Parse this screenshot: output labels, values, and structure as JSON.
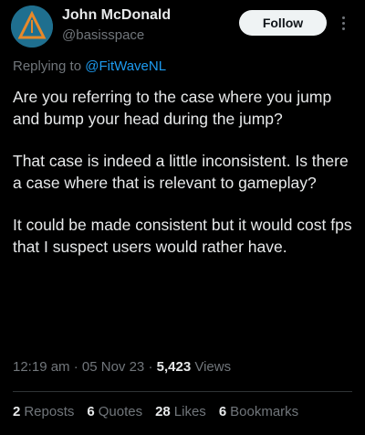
{
  "author": {
    "name": "John McDonald",
    "handle": "@basisspace"
  },
  "follow_label": "Follow",
  "reply": {
    "prefix": "Replying to ",
    "to": "@FitWaveNL"
  },
  "tweet": {
    "paragraphs": [
      "Are you referring to the case where you jump and bump your head during the jump?",
      "That case is indeed a little inconsistent. Is there a case where that is relevant to gameplay?",
      "It could be made consistent but it would cost fps that I suspect users would rather have."
    ]
  },
  "meta": {
    "time": "12:19 am",
    "sep1": " · ",
    "date": "05 Nov 23",
    "sep2": " · ",
    "views_count": "5,423",
    "views_label": " Views"
  },
  "stats": [
    {
      "count": "2",
      "label": "Reposts"
    },
    {
      "count": "6",
      "label": "Quotes"
    },
    {
      "count": "28",
      "label": "Likes"
    },
    {
      "count": "6",
      "label": "Bookmarks"
    }
  ],
  "colors": {
    "background": "#000000",
    "text": "#e7e9ea",
    "muted": "#71767b",
    "link": "#1d9bf0",
    "avatar_bg": "#1f6f8f",
    "avatar_logo": "#e8892a"
  },
  "icons": {
    "avatar": "triangle-logo-avatar",
    "more": "more-vertical-icon"
  }
}
